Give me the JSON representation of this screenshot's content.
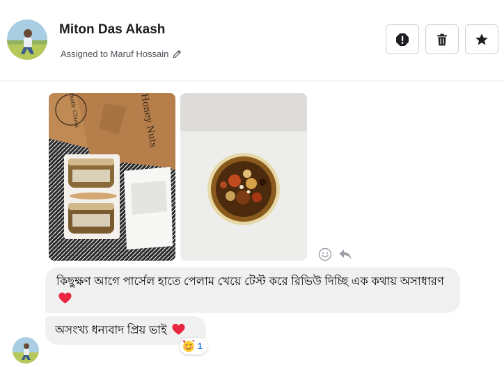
{
  "header": {
    "contact_name": "Miton Das Akash",
    "assigned_text": "Assigned to Maruf Hossain",
    "buttons": {
      "spam_icon": "exclamation-octagon-icon",
      "delete_icon": "trash-icon",
      "star_icon": "star-icon"
    }
  },
  "messages": [
    {
      "type": "images",
      "images": [
        {
          "label_top": "Khatir Chova",
          "label_box": "Honey Nuts"
        },
        {
          "label": ""
        }
      ]
    },
    {
      "type": "text",
      "text": "কিছুক্ষণ আগে পার্সেল হাতে পেলাম খেয়ে টেস্ট করে রিভিউ দিচ্ছি এক কথায় অসাধারণ",
      "emoji": "heart"
    },
    {
      "type": "text",
      "text": "অসংখ্য ধন্যবাদ প্রিয় ভাই",
      "emoji": "heart",
      "reaction": {
        "emoji": "smiling-face-with-hearts",
        "count": "1"
      }
    }
  ],
  "colors": {
    "bubble_bg": "#f0f0f0",
    "heart": "#e8263f",
    "reaction_count": "#1876f2",
    "icon_dark": "#1c1e21"
  }
}
